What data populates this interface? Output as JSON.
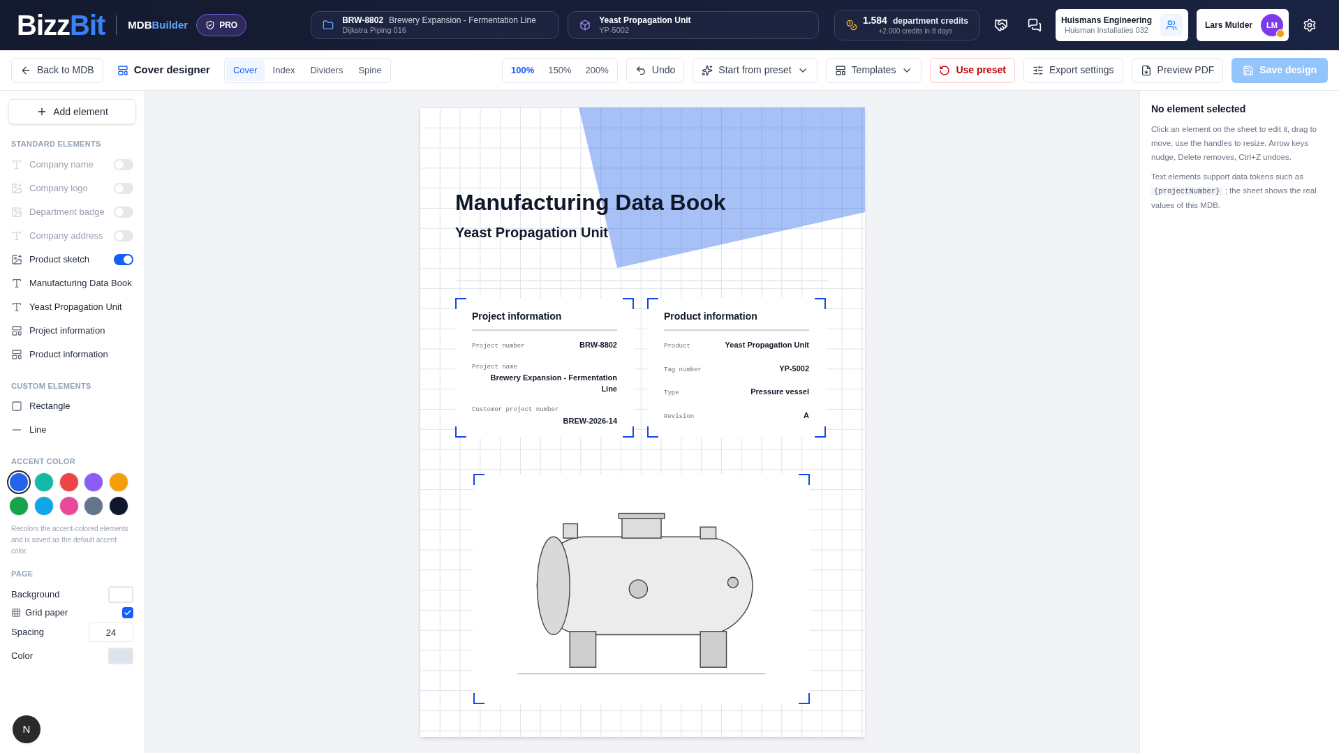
{
  "header": {
    "logo": {
      "first": "Bizz",
      "second": "Bit"
    },
    "product": {
      "first": "MDB",
      "second": "Builder"
    },
    "plan_badge": "PRO",
    "project": {
      "code": "BRW-8802",
      "name": "Brewery Expansion - Fermentation Line",
      "client": "Dijkstra Piping 016"
    },
    "unit": {
      "name": "Yeast Propagation Unit",
      "tag": "YP-5002"
    },
    "credits": {
      "amount": "1.584",
      "label": "department credits",
      "note": "+2.000 credits in 8 days"
    },
    "company": {
      "name": "Huismans Engineering",
      "sub": "Huisman Installaties 032"
    },
    "user": {
      "name": "Lars Mulder",
      "initials": "LM"
    }
  },
  "toolbar": {
    "back": "Back to MDB",
    "title": "Cover designer",
    "tabs": [
      {
        "label": "Cover",
        "selected": true
      },
      {
        "label": "Index",
        "selected": false
      },
      {
        "label": "Dividers",
        "selected": false
      },
      {
        "label": "Spine",
        "selected": false
      }
    ],
    "zoom": [
      {
        "label": "100%",
        "selected": true
      },
      {
        "label": "150%",
        "selected": false
      },
      {
        "label": "200%",
        "selected": false
      }
    ],
    "undo": "Undo",
    "start_preset": "Start from preset",
    "templates": "Templates",
    "use_preset": "Use preset",
    "export": "Export settings",
    "preview": "Preview PDF",
    "save": {
      "label": "Save design",
      "disabled": true
    }
  },
  "sidebar": {
    "add": "Add element",
    "standard_heading": "STANDARD ELEMENTS",
    "standard": [
      {
        "label": "Company name",
        "kind": "text",
        "on": false
      },
      {
        "label": "Company logo",
        "kind": "image",
        "on": false
      },
      {
        "label": "Department badge",
        "kind": "image",
        "on": false
      },
      {
        "label": "Company address",
        "kind": "text",
        "on": false
      },
      {
        "label": "Product sketch",
        "kind": "image",
        "on": true
      },
      {
        "label": "Manufacturing Data Book",
        "kind": "text"
      },
      {
        "label": "Yeast Propagation Unit",
        "kind": "text"
      },
      {
        "label": "Project information",
        "kind": "layout"
      },
      {
        "label": "Product information",
        "kind": "layout"
      }
    ],
    "custom_heading": "CUSTOM ELEMENTS",
    "custom": [
      {
        "label": "Rectangle",
        "kind": "square"
      },
      {
        "label": "Line",
        "kind": "line"
      }
    ],
    "accent_heading": "ACCENT COLOR",
    "accents": [
      {
        "color": "#2563eb",
        "selected": true
      },
      {
        "color": "#14b8a6",
        "selected": false
      },
      {
        "color": "#ef4444",
        "selected": false
      },
      {
        "color": "#8b5cf6",
        "selected": false
      },
      {
        "color": "#f59e0b",
        "selected": false
      },
      {
        "color": "#16a34a",
        "selected": false
      },
      {
        "color": "#0ea5e9",
        "selected": false
      },
      {
        "color": "#ec4899",
        "selected": false
      },
      {
        "color": "#64748b",
        "selected": false
      },
      {
        "color": "#0f172a",
        "selected": false
      }
    ],
    "accent_note": "Recolors the accent-colored elements and is saved as the default accent color.",
    "page_heading": "PAGE",
    "background_label": "Background",
    "grid_label": "Grid paper",
    "grid_checked": true,
    "spacing_label": "Spacing",
    "spacing": "24",
    "color_label": "Color"
  },
  "sheet": {
    "title": "Manufacturing Data Book",
    "subtitle": "Yeast Propagation Unit",
    "cards": [
      {
        "title": "Project information",
        "rows": [
          {
            "label": "Project number",
            "value": "BRW-8802"
          },
          {
            "label": "Project name",
            "value": "Brewery Expansion - Fermentation Line",
            "stacked": true
          },
          {
            "label": "Customer project number",
            "value": "BREW-2026-14",
            "stacked": true
          }
        ]
      },
      {
        "title": "Product information",
        "rows": [
          {
            "label": "Product",
            "value": "Yeast Propagation Unit"
          },
          {
            "label": "Tag number",
            "value": "YP-5002"
          },
          {
            "label": "Type",
            "value": "Pressure vessel"
          },
          {
            "label": "Revision",
            "value": "A"
          }
        ]
      }
    ]
  },
  "inspector": {
    "title": "No element selected",
    "help": "Click an element on the sheet to edit it, drag to move, use the handles to resize. Arrow keys nudge, Delete removes, Ctrl+Z undoes.",
    "token_intro": "Text elements support data tokens such as",
    "token": "{projectNumber}",
    "token_outro": "; the sheet shows the real values of this MDB."
  },
  "dev_badge": "N"
}
